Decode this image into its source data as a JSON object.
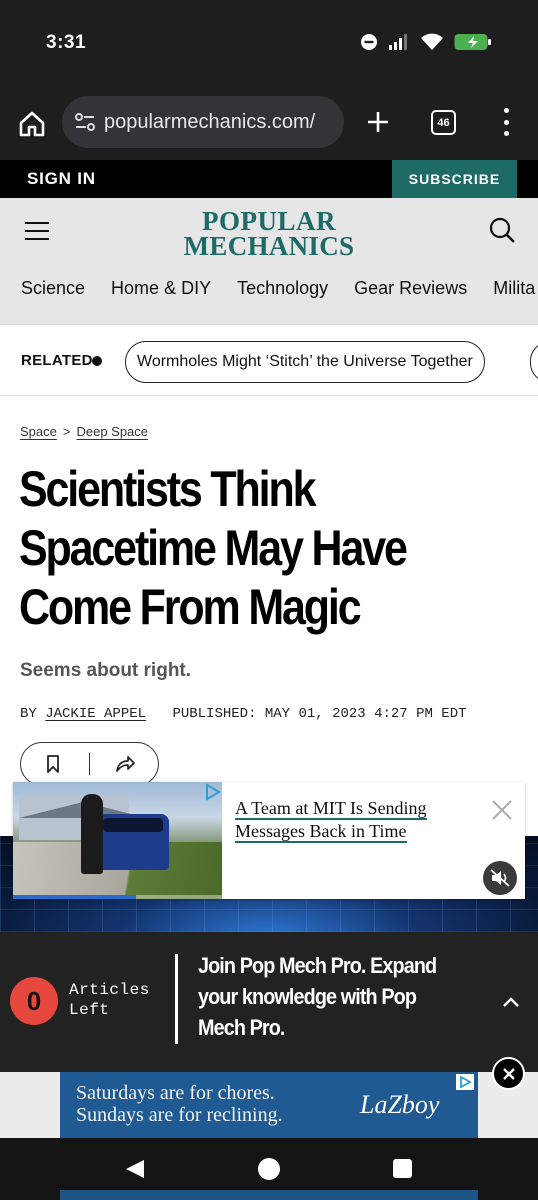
{
  "status_bar": {
    "time": "3:31"
  },
  "browser": {
    "url": "popularmechanics.com/",
    "tab_count": "46"
  },
  "account_bar": {
    "sign_in": "SIGN IN",
    "subscribe": "SUBSCRIBE"
  },
  "header": {
    "logo_line1": "POPULAR",
    "logo_line2": "MECHANICS",
    "nav": [
      "Science",
      "Home & DIY",
      "Technology",
      "Gear Reviews",
      "Milita"
    ]
  },
  "related": {
    "label": "RELATED",
    "pill": "Wormholes Might ‘Stitch’ the Universe Together"
  },
  "article": {
    "breadcrumb": [
      "Space",
      ">",
      "Deep Space"
    ],
    "headline": "Scientists Think Spacetime May Have Come From Magic",
    "dek": "Seems about right.",
    "by_label": "BY",
    "author": "JACKIE APPEL",
    "published": "PUBLISHED: MAY 01, 2023 4:27 PM EDT"
  },
  "video_ad": {
    "title": "A Team at MIT Is Sending Messages Back in Time",
    "progress": 0.59
  },
  "pro_bar": {
    "count": "0",
    "articles_left_line1": "Articles",
    "articles_left_line2": "Left",
    "pitch": "Join Pop Mech Pro. Expand your knowledge with Pop Mech Pro."
  },
  "bottom_ad": {
    "line1": "Saturdays are for chores.",
    "line2": "Sundays are for reclining.",
    "brand": "LaZboy"
  },
  "colors": {
    "brand_teal": "#1d6b66",
    "subscribe_bg": "#1e6b66",
    "counter_red": "#e6483d"
  }
}
